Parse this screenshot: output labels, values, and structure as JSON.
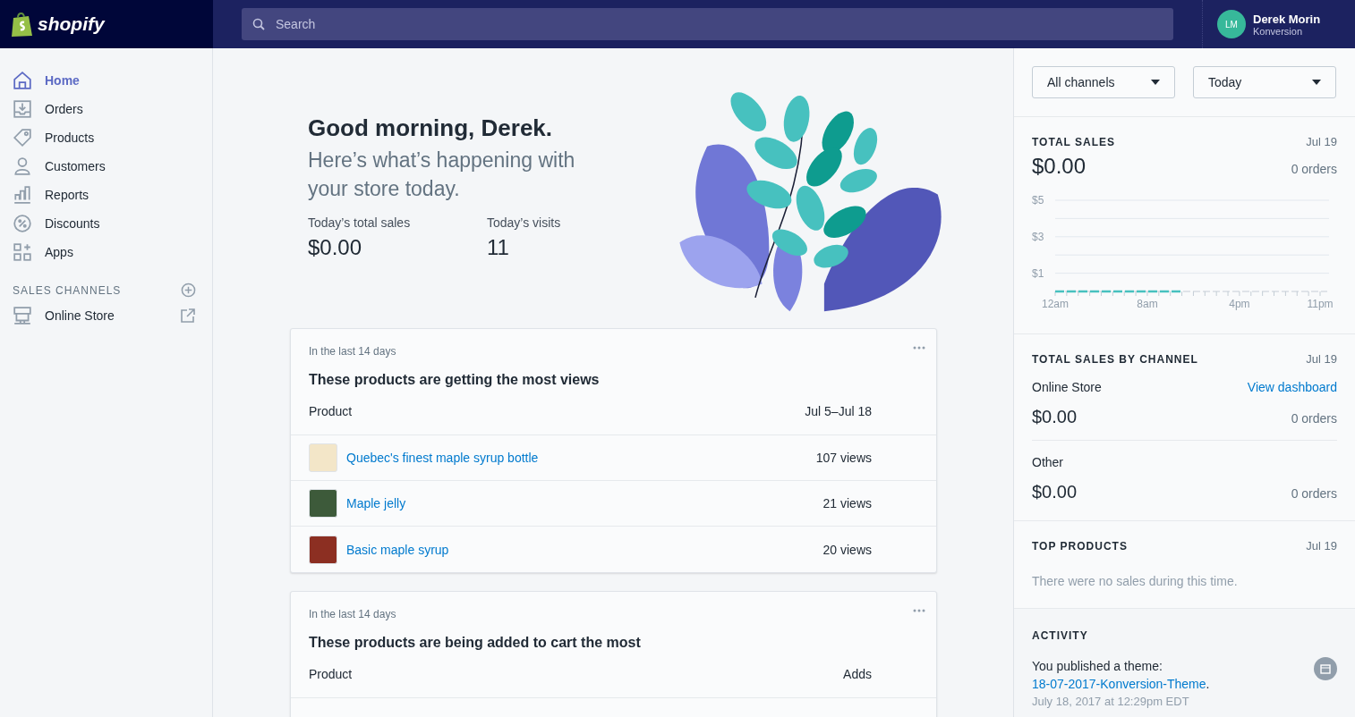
{
  "topbar": {
    "logo": "shopify",
    "search": {
      "placeholder": "Search"
    },
    "user": {
      "name": "Derek Morin",
      "store": "Konversion",
      "initials": "LM"
    }
  },
  "sidebar": {
    "items": [
      {
        "label": "Home",
        "selected": true
      },
      {
        "label": "Orders",
        "selected": false
      },
      {
        "label": "Products",
        "selected": false
      },
      {
        "label": "Customers",
        "selected": false
      },
      {
        "label": "Reports",
        "selected": false
      },
      {
        "label": "Discounts",
        "selected": false
      },
      {
        "label": "Apps",
        "selected": false
      }
    ],
    "section_title": "SALES CHANNELS",
    "channels": [
      {
        "label": "Online Store",
        "selected": false
      }
    ]
  },
  "hero": {
    "greeting": "Good morning, Derek.",
    "subtitle": "Here’s what’s happening with your store today.",
    "stats": [
      {
        "label": "Today’s total sales",
        "value": "$0.00"
      },
      {
        "label": "Today’s visits",
        "value": "11"
      }
    ]
  },
  "cards": [
    {
      "caption": "In the last 14 days",
      "title": "These products are getting the most views",
      "columns": [
        "Product",
        "Jul 5–Jul 18"
      ],
      "rows": [
        {
          "product": "Quebec's finest maple syrup bottle",
          "value": "107 views"
        },
        {
          "product": "Maple jelly",
          "value": "21 views"
        },
        {
          "product": "Basic maple syrup",
          "value": "20 views"
        }
      ]
    },
    {
      "caption": "In the last 14 days",
      "title": "These products are being added to cart the most",
      "columns": [
        "Product",
        "Adds"
      ]
    }
  ],
  "filters": [
    {
      "label": "All channels"
    },
    {
      "label": "Today"
    }
  ],
  "total_sales": {
    "title": "TOTAL SALES",
    "date": "Jul 19",
    "amount": "$0.00",
    "orders": "0 orders",
    "chart_data": {
      "type": "line",
      "categories": [
        "12am",
        null,
        null,
        null,
        null,
        null,
        null,
        null,
        "8am",
        null,
        null,
        null,
        null,
        null,
        null,
        null,
        "4pm",
        null,
        null,
        null,
        null,
        null,
        null,
        "11pm"
      ],
      "series": [
        {
          "color": "#47c1bf",
          "line_style": "dashed",
          "values": [
            0,
            0,
            0,
            0,
            0,
            0,
            0,
            0,
            0,
            0,
            0,
            0,
            null,
            null,
            null,
            null,
            null,
            null,
            null,
            null,
            null,
            null,
            null,
            null
          ]
        }
      ],
      "ylim": [
        0,
        5
      ],
      "yticks": [
        {
          "value": 1,
          "label": "$1"
        },
        {
          "value": 3,
          "label": "$3"
        },
        {
          "value": 5,
          "label": "$5"
        }
      ]
    }
  },
  "by_channel": {
    "title": "TOTAL SALES BY CHANNEL",
    "date": "Jul 19",
    "channels": [
      {
        "name": "Online Store",
        "link": "View dashboard",
        "amount": "$0.00",
        "orders": "0 orders"
      },
      {
        "name": "Other",
        "amount": "$0.00",
        "orders": "0 orders"
      }
    ]
  },
  "top_products": {
    "title": "TOP PRODUCTS",
    "date": "Jul 19",
    "empty": "There were no sales during this time."
  },
  "activity": {
    "title": "ACTIVITY",
    "items": [
      {
        "text": "You published a theme: ",
        "link": "18-07-2017-Konversion-Theme",
        "suffix": ".",
        "time": "July 18, 2017 at 12:29pm EDT"
      }
    ]
  }
}
